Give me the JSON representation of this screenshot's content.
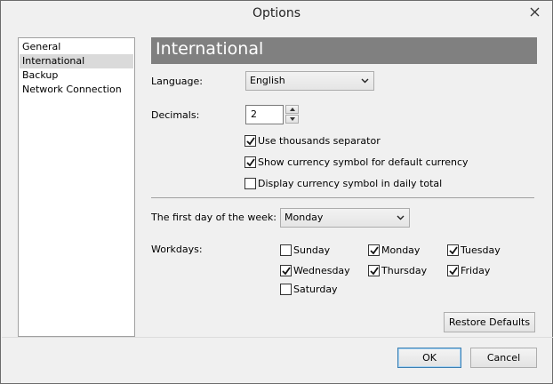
{
  "window": {
    "title": "Options"
  },
  "nav": {
    "items": [
      {
        "label": "General"
      },
      {
        "label": "International",
        "selected": true
      },
      {
        "label": "Backup"
      },
      {
        "label": "Network Connection"
      }
    ]
  },
  "section": {
    "heading": "International"
  },
  "language": {
    "label": "Language:",
    "value": "English"
  },
  "decimals": {
    "label": "Decimals:",
    "value": "2"
  },
  "options": {
    "thousands": {
      "label": "Use thousands separator",
      "checked": true
    },
    "currency_default": {
      "label": "Show currency symbol for default currency",
      "checked": true
    },
    "currency_daily": {
      "label": "Display currency symbol in daily total",
      "checked": false
    }
  },
  "first_day": {
    "label": "The first day of the week:",
    "value": "Monday"
  },
  "workdays": {
    "label": "Workdays:",
    "days": [
      {
        "label": "Sunday",
        "checked": false
      },
      {
        "label": "Monday",
        "checked": true
      },
      {
        "label": "Tuesday",
        "checked": true
      },
      {
        "label": "Wednesday",
        "checked": true
      },
      {
        "label": "Thursday",
        "checked": true
      },
      {
        "label": "Friday",
        "checked": true
      },
      {
        "label": "Saturday",
        "checked": false
      }
    ]
  },
  "buttons": {
    "restore": "Restore Defaults",
    "ok": "OK",
    "cancel": "Cancel"
  },
  "icons": {
    "close": "close-icon",
    "dropdown": "chevron-down-icon",
    "check": "checkmark-icon"
  },
  "colors": {
    "heading_bar": "#808080",
    "window_bg": "#f0f0f0",
    "default_button_border": "#3c7fb1"
  }
}
